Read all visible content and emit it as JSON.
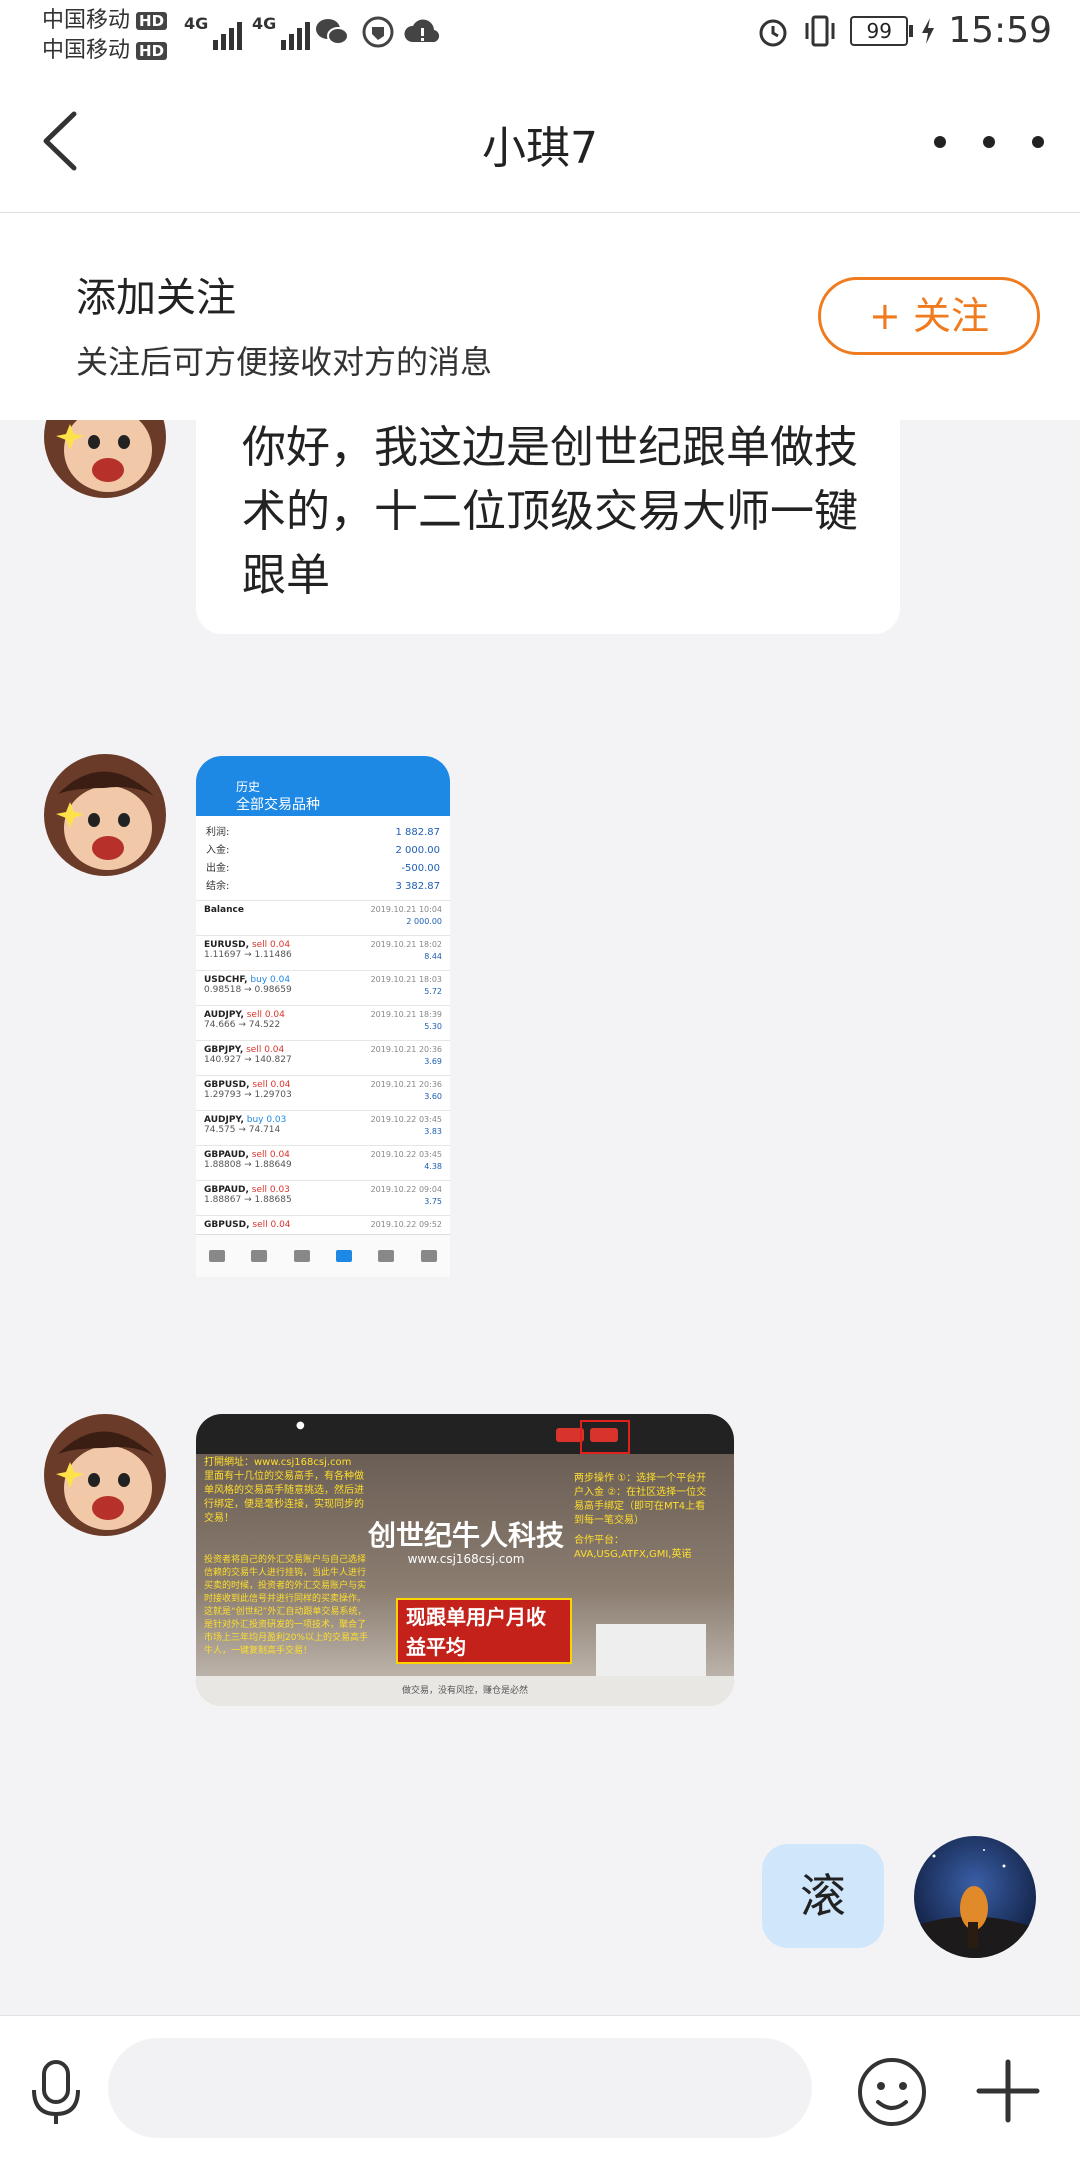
{
  "status_bar": {
    "carrier1": "中国移动",
    "carrier2": "中国移动",
    "hd": "HD",
    "net": "4G",
    "battery": "99",
    "time": "15:59"
  },
  "header": {
    "title": "小琪7"
  },
  "follow": {
    "title": "添加关注",
    "subtitle": "关注后可方便接收对方的消息",
    "button": "+ 关注"
  },
  "messages": {
    "m1_text": "你好，我这边是创世纪跟单做技术的，十二位顶级交易大师一键跟单",
    "m4_text": "滚"
  },
  "image1": {
    "header_small": "历史",
    "header_title": "全部交易品种",
    "summary": [
      {
        "label": "利润:",
        "value": "1 882.87"
      },
      {
        "label": "入金:",
        "value": "2 000.00"
      },
      {
        "label": "出金:",
        "value": "-500.00"
      },
      {
        "label": "结余:",
        "value": "3 382.87"
      }
    ],
    "balance_label": "Balance",
    "balance_date": "2019.10.21 10:04",
    "balance_value": "2 000.00",
    "trades": [
      {
        "pair": "EURUSD,",
        "side": "sell 0.04",
        "prices": "1.11697 → 1.11486",
        "date": "2019.10.21 18:02",
        "profit": "8.44"
      },
      {
        "pair": "USDCHF,",
        "side": "buy 0.04",
        "prices": "0.98518 → 0.98659",
        "date": "2019.10.21 18:03",
        "profit": "5.72"
      },
      {
        "pair": "AUDJPY,",
        "side": "sell 0.04",
        "prices": "74.666 → 74.522",
        "date": "2019.10.21 18:39",
        "profit": "5.30"
      },
      {
        "pair": "GBPJPY,",
        "side": "sell 0.04",
        "prices": "140.927 → 140.827",
        "date": "2019.10.21 20:36",
        "profit": "3.69"
      },
      {
        "pair": "GBPUSD,",
        "side": "sell 0.04",
        "prices": "1.29793 → 1.29703",
        "date": "2019.10.21 20:36",
        "profit": "3.60"
      },
      {
        "pair": "AUDJPY,",
        "side": "buy 0.03",
        "prices": "74.575 → 74.714",
        "date": "2019.10.22 03:45",
        "profit": "3.83"
      },
      {
        "pair": "GBPAUD,",
        "side": "sell 0.04",
        "prices": "1.88808 → 1.88649",
        "date": "2019.10.22 03:45",
        "profit": "4.38"
      },
      {
        "pair": "GBPAUD,",
        "side": "sell 0.03",
        "prices": "1.88867 → 1.88685",
        "date": "2019.10.22 09:04",
        "profit": "3.75"
      },
      {
        "pair": "GBPUSD,",
        "side": "sell 0.04",
        "prices": "",
        "date": "2019.10.22 09:52",
        "profit": ""
      }
    ]
  },
  "image2": {
    "url_line": "打開網址：www.csj168csj.com",
    "left_text": "里面有十几位的交易高手，有各种做单风格的交易高手随意挑选，然后进行绑定，便是毫秒连接，实现同步的交易！",
    "left_text2": "投资者将自己的外汇交易账户与自己选择信赖的交易牛人进行挂钩，当此牛人进行买卖的时候，投资者的外汇交易账户与实时接收到此信号并进行同样的买卖操作。这就是“创世纪”外汇自动跟单交易系统，是针对外汇投资研发的一项技术，聚合了市场上三年均月盈利20%以上的交易高手牛人，一键复制高手交易！",
    "title": "创世纪牛人科技",
    "url": "www.csj168csj.com",
    "red_panel": "现跟单用户月收益平均",
    "right_text": "两步操作 ①：选择一个平台开户入金 ②：在社区选择一位交易高手绑定（即可在MT4上看到每一笔交易）",
    "partners": "合作平台：AVA,USG,ATFX,GMI,英诺",
    "footer": "做交易，没有风控，赚仓是必然"
  }
}
